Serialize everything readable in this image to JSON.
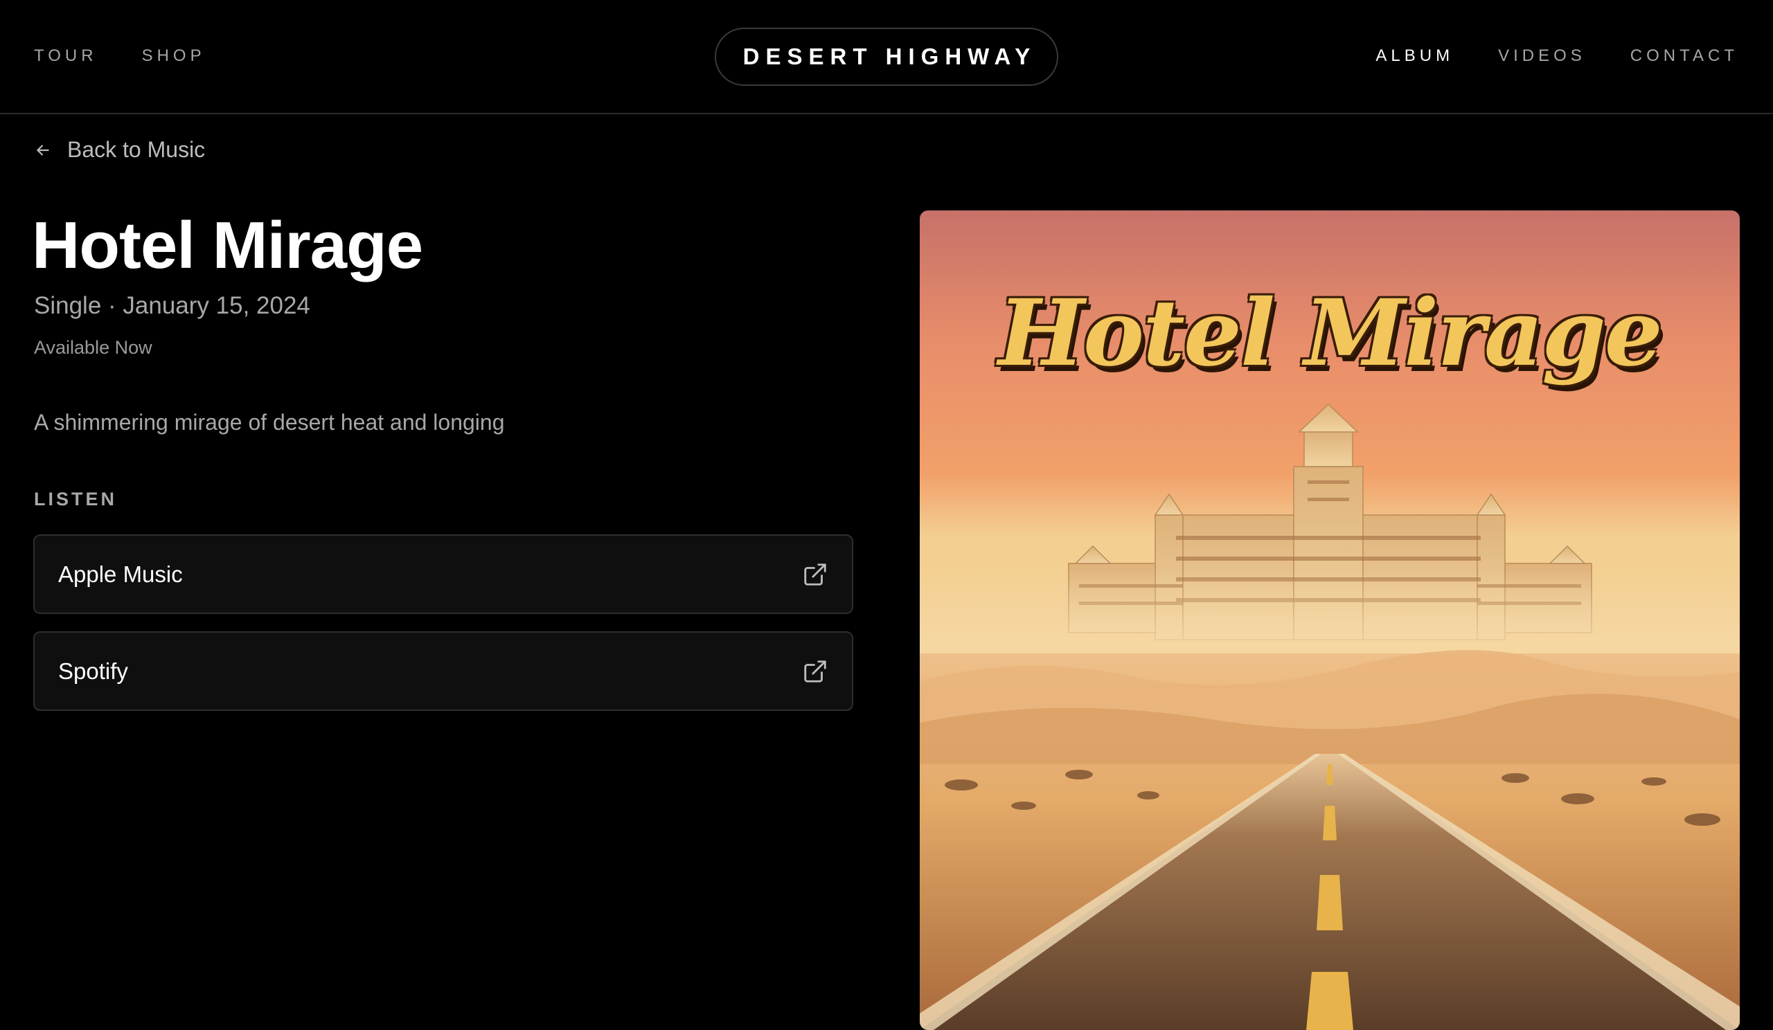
{
  "header": {
    "nav_left": [
      {
        "label": "TOUR"
      },
      {
        "label": "SHOP"
      }
    ],
    "brand": "DESERT HIGHWAY",
    "nav_right": [
      {
        "label": "ALBUM",
        "active": true
      },
      {
        "label": "VIDEOS",
        "active": false
      },
      {
        "label": "CONTACT",
        "active": false
      }
    ]
  },
  "back_link": {
    "icon": "arrow-left-icon",
    "label": "Back to Music"
  },
  "release": {
    "title": "Hotel Mirage",
    "meta": "Single · January 15, 2024",
    "availability": "Available Now",
    "description": "A shimmering mirage of desert heat and longing"
  },
  "listen": {
    "heading": "LISTEN",
    "services": [
      {
        "label": "Apple Music",
        "icon": "external-link-icon"
      },
      {
        "label": "Spotify",
        "icon": "external-link-icon"
      }
    ]
  },
  "artwork": {
    "title_text": "Hotel Mirage",
    "colors": {
      "sky_top": "#c7716a",
      "sky_mid": "#f2a06a",
      "horizon": "#f3cf92",
      "sand": "#e3a968",
      "road": "#6b4a32",
      "title_fill": "#f3c65c"
    }
  },
  "theme": {
    "background": "#000000",
    "text_primary": "#ffffff",
    "text_muted": "#a8a8a8",
    "card_bg": "#0f0f0f",
    "card_border": "#2e2e2e"
  }
}
